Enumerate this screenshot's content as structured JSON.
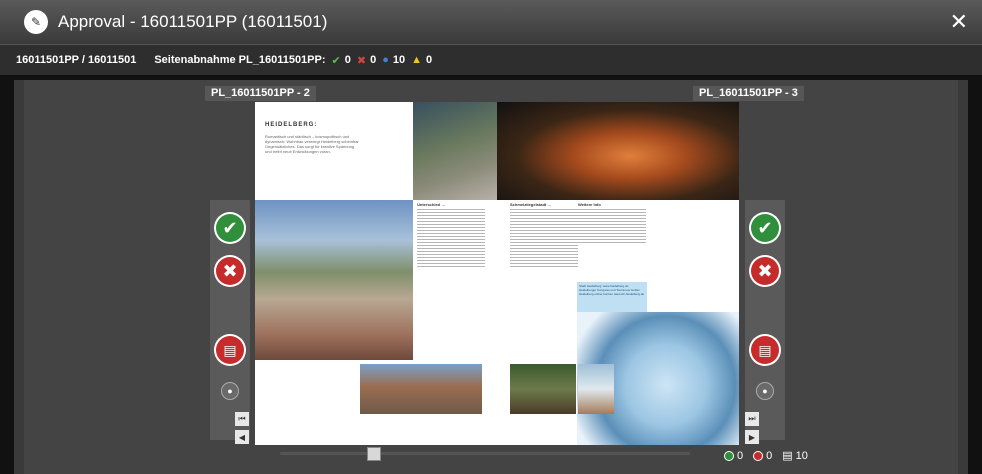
{
  "window": {
    "title": "Approval - 16011501PP (16011501)"
  },
  "infobar": {
    "id": "16011501PP / 16011501",
    "label": "Seitenabnahme PL_16011501PP:",
    "approved_count": "0",
    "rejected_count": "0",
    "pending_count": "10",
    "warning_count": "0"
  },
  "pages": {
    "left_label": "PL_16011501PP - 2",
    "right_label": "PL_16011501PP - 3"
  },
  "content": {
    "heading": "HEIDELBERG:",
    "lede": "Romantisch und städtisch – kosmopolitisch und dynamisch: Wohnbau verwirrgt Heidelberg scheinbar Gegensätzliches. Das sorgt für kreative Spannung und treibt neue Entwicklungen voran.",
    "col1_heading": "Unterschied …",
    "col2_heading": "Schmelztiegelstadt …",
    "col3_heading": "Weitere Info",
    "info_box": "Stadt Heidelberg: www.heidelberg.de Heidelberger Kongress und Tourismus GmbH Heidelberg online buchen www.ich-heidelberg.de"
  },
  "footer": {
    "approved": "0",
    "rejected": "0",
    "pending": "10"
  },
  "colors": {
    "approve": "#2f8f3a",
    "reject": "#c52b2b",
    "pending": "#3b82d4",
    "warning": "#f0c419"
  },
  "icons": {
    "app": "approval-icon",
    "close": "close-icon",
    "approve": "checkmark-icon",
    "reject": "cross-icon",
    "revision": "book-icon",
    "zoom": "magnify-icon",
    "nav_first": "first-page-icon",
    "nav_prev": "prev-page-icon",
    "nav_last": "last-page-icon",
    "nav_next": "next-page-icon"
  }
}
